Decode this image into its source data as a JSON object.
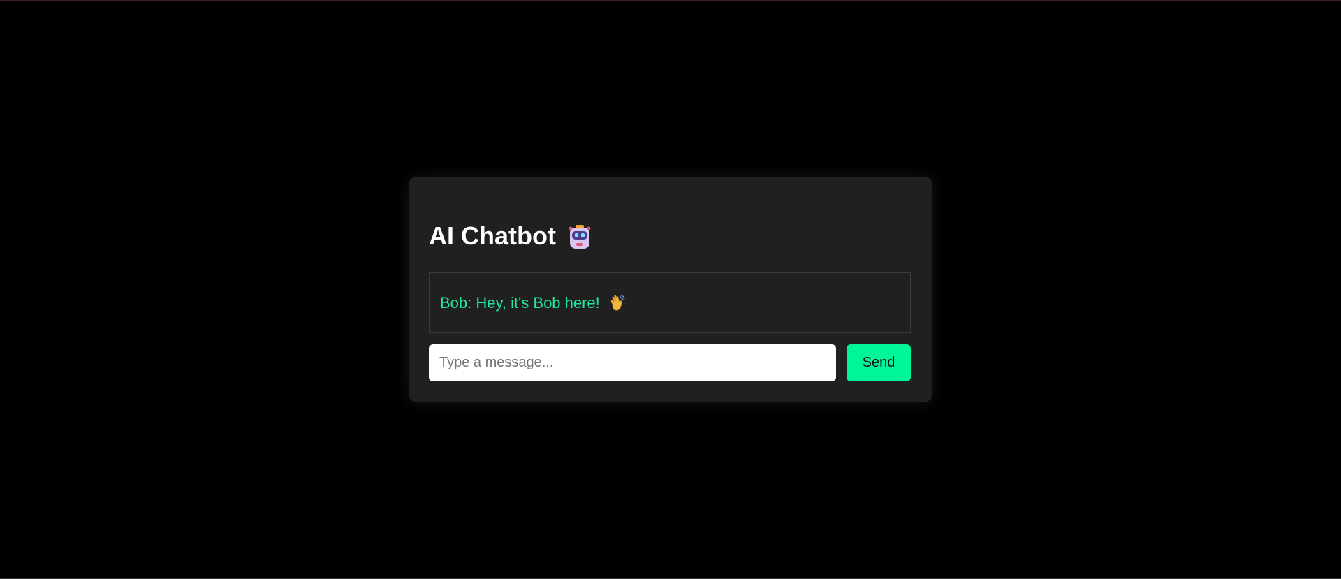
{
  "app": {
    "title": "AI Chatbot",
    "title_icon": "robot-icon"
  },
  "chat": {
    "messages": [
      {
        "text": "Bob: Hey, it's Bob here!",
        "icon": "waving-hand-icon"
      }
    ]
  },
  "composer": {
    "placeholder": "Type a message...",
    "value": "",
    "send_label": "Send"
  },
  "colors": {
    "background": "#000000",
    "card": "#202020",
    "accent": "#00f59a",
    "message_text": "#21e89b"
  }
}
